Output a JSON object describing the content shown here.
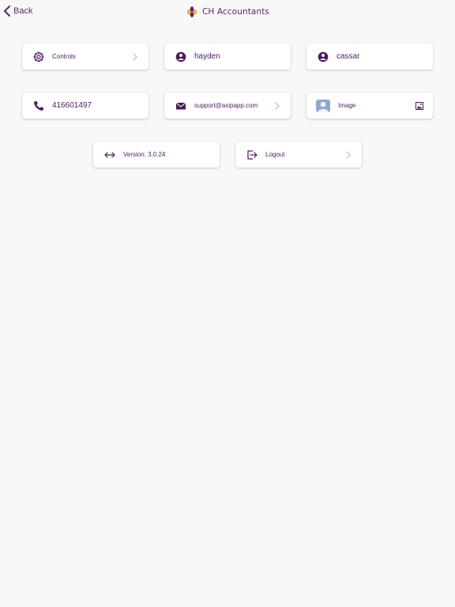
{
  "header": {
    "back_label": "Back",
    "brand_name": "CH Accountants"
  },
  "cards": {
    "controls": {
      "label": "Controls"
    },
    "first_name": {
      "label": "hayden"
    },
    "last_name": {
      "label": "cassar"
    },
    "phone": {
      "label": "416601497"
    },
    "email": {
      "label": "support@axipapp.com"
    },
    "image": {
      "label": "Image"
    },
    "version": {
      "label": "Version: 3.0.24"
    },
    "logout": {
      "label": "Logout"
    }
  },
  "colors": {
    "accent": "#5b2670",
    "background": "#f8f8f9",
    "logo_yellow": "#f5b32c",
    "logo_purple": "#5b2670",
    "avatar_blue": "#8fa7cf",
    "chevron_gray": "#b9b9c0"
  },
  "icons": {
    "back": "chevron-left-icon",
    "controls": "gear-icon",
    "user": "user-circle-icon",
    "phone": "phone-icon",
    "email": "envelope-icon",
    "avatar": "avatar-icon",
    "image": "image-icon",
    "version": "code-icon",
    "logout": "logout-icon",
    "chevron": "chevron-right-icon"
  }
}
